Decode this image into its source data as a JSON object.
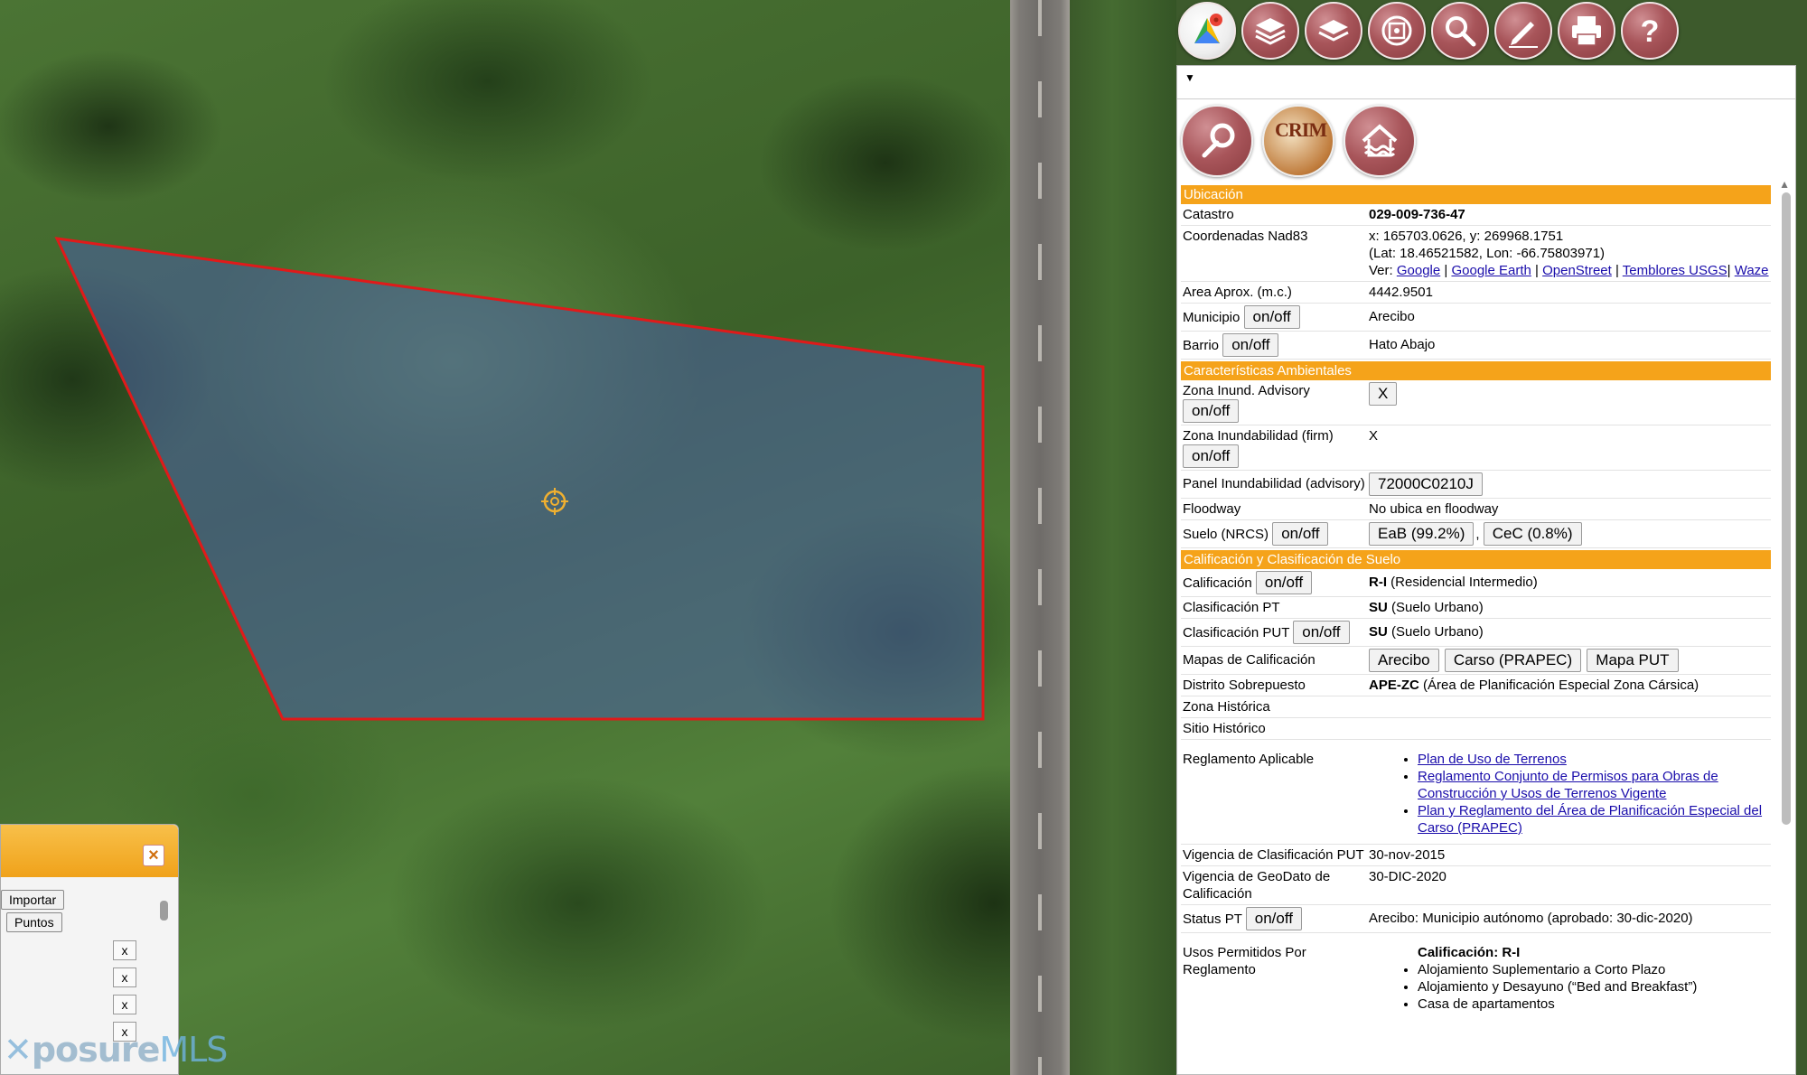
{
  "panel": {
    "sections": {
      "ubicacion": "Ubicación",
      "ambientales": "Características Ambientales",
      "calificacion": "Calificación y Clasificación de Suelo"
    },
    "rows": {
      "catastro": {
        "label": "Catastro",
        "value": "029-009-736-47"
      },
      "coords": {
        "label": "Coordenadas Nad83",
        "xy": "x: 165703.0626, y: 269968.1751",
        "latlon": "(Lat: 18.46521582, Lon: -66.75803971)",
        "ver": "Ver:",
        "links": [
          "Google",
          "Google Earth",
          "OpenStreet",
          "Temblores USGS",
          "Waze"
        ]
      },
      "area": {
        "label": "Area Aprox. (m.c.)",
        "value": "4442.9501"
      },
      "municipio": {
        "label": "Municipio",
        "button": "on/off",
        "value": "Arecibo"
      },
      "barrio": {
        "label": "Barrio",
        "button": "on/off",
        "value": "Hato Abajo"
      },
      "zona_advisory": {
        "label": "Zona Inund. Advisory",
        "button": "on/off",
        "value_button": "X"
      },
      "zona_firm": {
        "label": "Zona Inundabilidad (firm)",
        "button": "on/off",
        "value": "X"
      },
      "panel_inund": {
        "label": "Panel Inundabilidad (advisory)",
        "value_button": "72000C0210J"
      },
      "floodway": {
        "label": "Floodway",
        "value": "No ubica en floodway"
      },
      "suelo": {
        "label": "Suelo (NRCS)",
        "button": "on/off",
        "values": [
          "EaB (99.2%)",
          "CeC (0.8%)"
        ]
      },
      "calif": {
        "label": "Calificación",
        "button": "on/off",
        "code": "R-I",
        "desc": "(Residencial Intermedio)"
      },
      "clas_pt": {
        "label": "Clasificación PT",
        "code": "SU",
        "desc": "(Suelo Urbano)"
      },
      "clas_put": {
        "label": "Clasificación PUT",
        "button": "on/off",
        "code": "SU",
        "desc": "(Suelo Urbano)"
      },
      "mapas": {
        "label": "Mapas de Calificación",
        "buttons": [
          "Arecibo",
          "Carso (PRAPEC)",
          "Mapa PUT"
        ]
      },
      "distrito": {
        "label": "Distrito Sobrepuesto",
        "code": "APE-ZC",
        "desc": "(Área de Planificación Especial Zona Cársica)"
      },
      "zona_hist": {
        "label": "Zona Histórica"
      },
      "sitio_hist": {
        "label": "Sitio Histórico"
      },
      "reglamento": {
        "label": "Reglamento Aplicable",
        "links": [
          "Plan de Uso de Terrenos",
          "Reglamento Conjunto de Permisos para Obras de Construcción y Usos de Terrenos Vigente",
          "Plan y Reglamento del Área de Planificación Especial del Carso (PRAPEC)"
        ]
      },
      "vig_put": {
        "label": "Vigencia de Clasificación PUT",
        "value": "30-nov-2015"
      },
      "vig_geo": {
        "label": "Vigencia de GeoDato de Calificación",
        "value": "30-DIC-2020"
      },
      "status_pt": {
        "label": "Status PT",
        "button": "on/off",
        "value": "Arecibo: Municipio autónomo (aprobado: 30-dic-2020)"
      },
      "usos": {
        "label": "Usos Permitidos Por Reglamento",
        "head": "Calificación: R-I",
        "items": [
          "Alojamiento Suplementario a Corto Plazo",
          "Alojamiento y Desayuno (“Bed and Breakfast”)",
          "Casa de apartamentos"
        ]
      }
    },
    "crim_text": "CRIM"
  },
  "dialog": {
    "close": "×",
    "importar": "Importar",
    "puntos": "Puntos",
    "x_buttons": [
      "x",
      "x",
      "x",
      "x"
    ]
  },
  "watermark": {
    "main": "posure",
    "accent": "MLS"
  },
  "toolbar": {
    "icons": [
      "google-maps-icon",
      "layers-icon",
      "layers-alt-icon",
      "gps-icon",
      "search-icon",
      "edit-icon",
      "print-icon",
      "help-icon"
    ]
  },
  "colors": {
    "section": "#f5a31a",
    "parcel_outline": "#e01a1a",
    "parcel_fill": "#4a5fa8",
    "link": "#1a0dab"
  }
}
